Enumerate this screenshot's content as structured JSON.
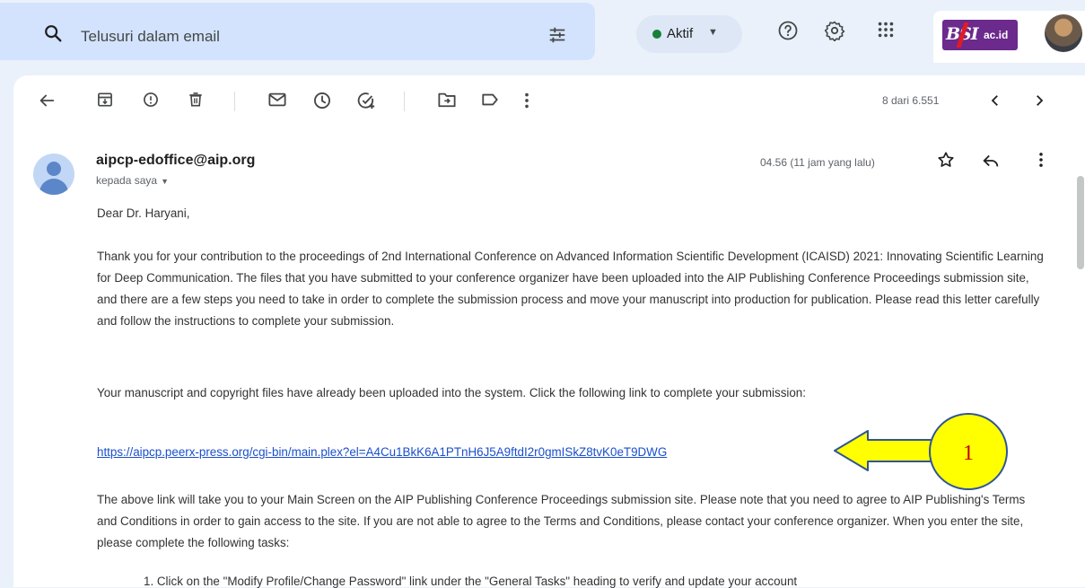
{
  "search": {
    "placeholder": "Telusuri dalam email"
  },
  "status": {
    "label": "Aktif",
    "color": "#188038"
  },
  "logo": {
    "text_main": "BSI",
    "text_suffix": "ac.id"
  },
  "toolbar": {
    "back": "arrow-left-icon",
    "icons": [
      "archive-icon",
      "report-spam-icon",
      "delete-icon",
      "mark-unread-icon",
      "snooze-icon",
      "add-task-icon",
      "move-to-icon",
      "label-icon",
      "more-vert-icon"
    ],
    "pager_text": "8 dari 6.551"
  },
  "email": {
    "sender": "aipcp-edoffice@aip.org",
    "recipient_label": "kepada saya",
    "time": "04.56 (11 jam yang lalu)",
    "greeting": "Dear Dr. Haryani,",
    "paragraph1": "Thank you for your contribution to the proceedings of 2nd International Conference on Advanced Information Scientific Development (ICAISD) 2021: Innovating Scientific Learning for Deep Communication. The files that you have submitted to your conference organizer have been uploaded into the AIP Publishing Conference Proceedings submission site, and there are a few steps you need to take in order to complete the submission process and move your manuscript into production for publication. Please read this letter carefully and follow the instructions to complete your submission.",
    "paragraph2": "Your manuscript and copyright files have already been uploaded into the system. Click the following link to complete your submission:",
    "link": "https://aipcp.peerx-press.org/cgi-bin/main.plex?el=A4Cu1BkK6A1PTnH6J5A9ftdI2r0gmISkZ8tvK0eT9DWG",
    "paragraph3": "The above link will take you to your Main Screen on the AIP Publishing Conference Proceedings submission site. Please note that you need to agree to AIP Publishing's Terms and Conditions in order to gain access to the site. If you are not able to agree to the Terms and Conditions, please contact your conference organizer. When you enter the site, please complete the following tasks:",
    "list_item_1": "1. Click on the \"Modify Profile/Change Password\" link under the \"General Tasks\" heading to verify and update your account"
  },
  "annotation": {
    "number": "1",
    "arrow_color": "#ffff00",
    "circle_color": "#ffff00",
    "number_color": "#c00000"
  }
}
